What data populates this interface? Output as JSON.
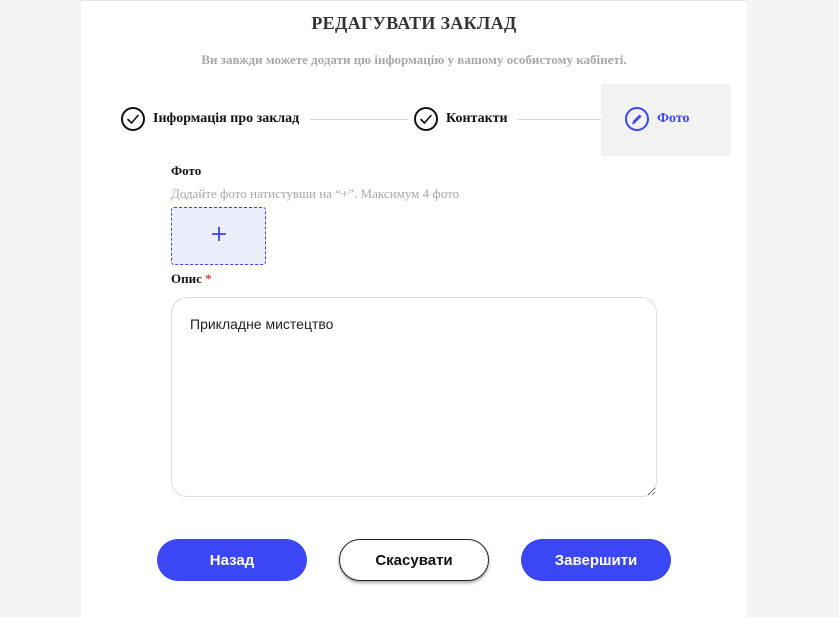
{
  "header": {
    "title": "РЕДАГУВАТИ ЗАКЛАД",
    "subtitle": "Ви завжди можете додати цю інформацію у вашому особистому кабінеті."
  },
  "stepper": {
    "steps": [
      {
        "label": "Інформація про заклад",
        "state": "done",
        "icon": "check-icon"
      },
      {
        "label": "Контакти",
        "state": "done",
        "icon": "check-icon"
      },
      {
        "label": "Фото",
        "state": "active",
        "icon": "pencil-icon"
      }
    ]
  },
  "photo": {
    "label": "Фото",
    "hint": "Додайте фото натистувши на “+”. Максимум 4 фото",
    "add_icon": "plus-icon"
  },
  "description": {
    "label": "Опис",
    "required_mark": "*",
    "value": "Прикладне мистецтво"
  },
  "buttons": {
    "back": "Назад",
    "cancel": "Скасувати",
    "finish": "Завершити"
  },
  "colors": {
    "accent": "#3b46f5",
    "required": "#e53935",
    "muted_text": "#a8a8a8",
    "active_step_bg": "#f2f2f2"
  }
}
